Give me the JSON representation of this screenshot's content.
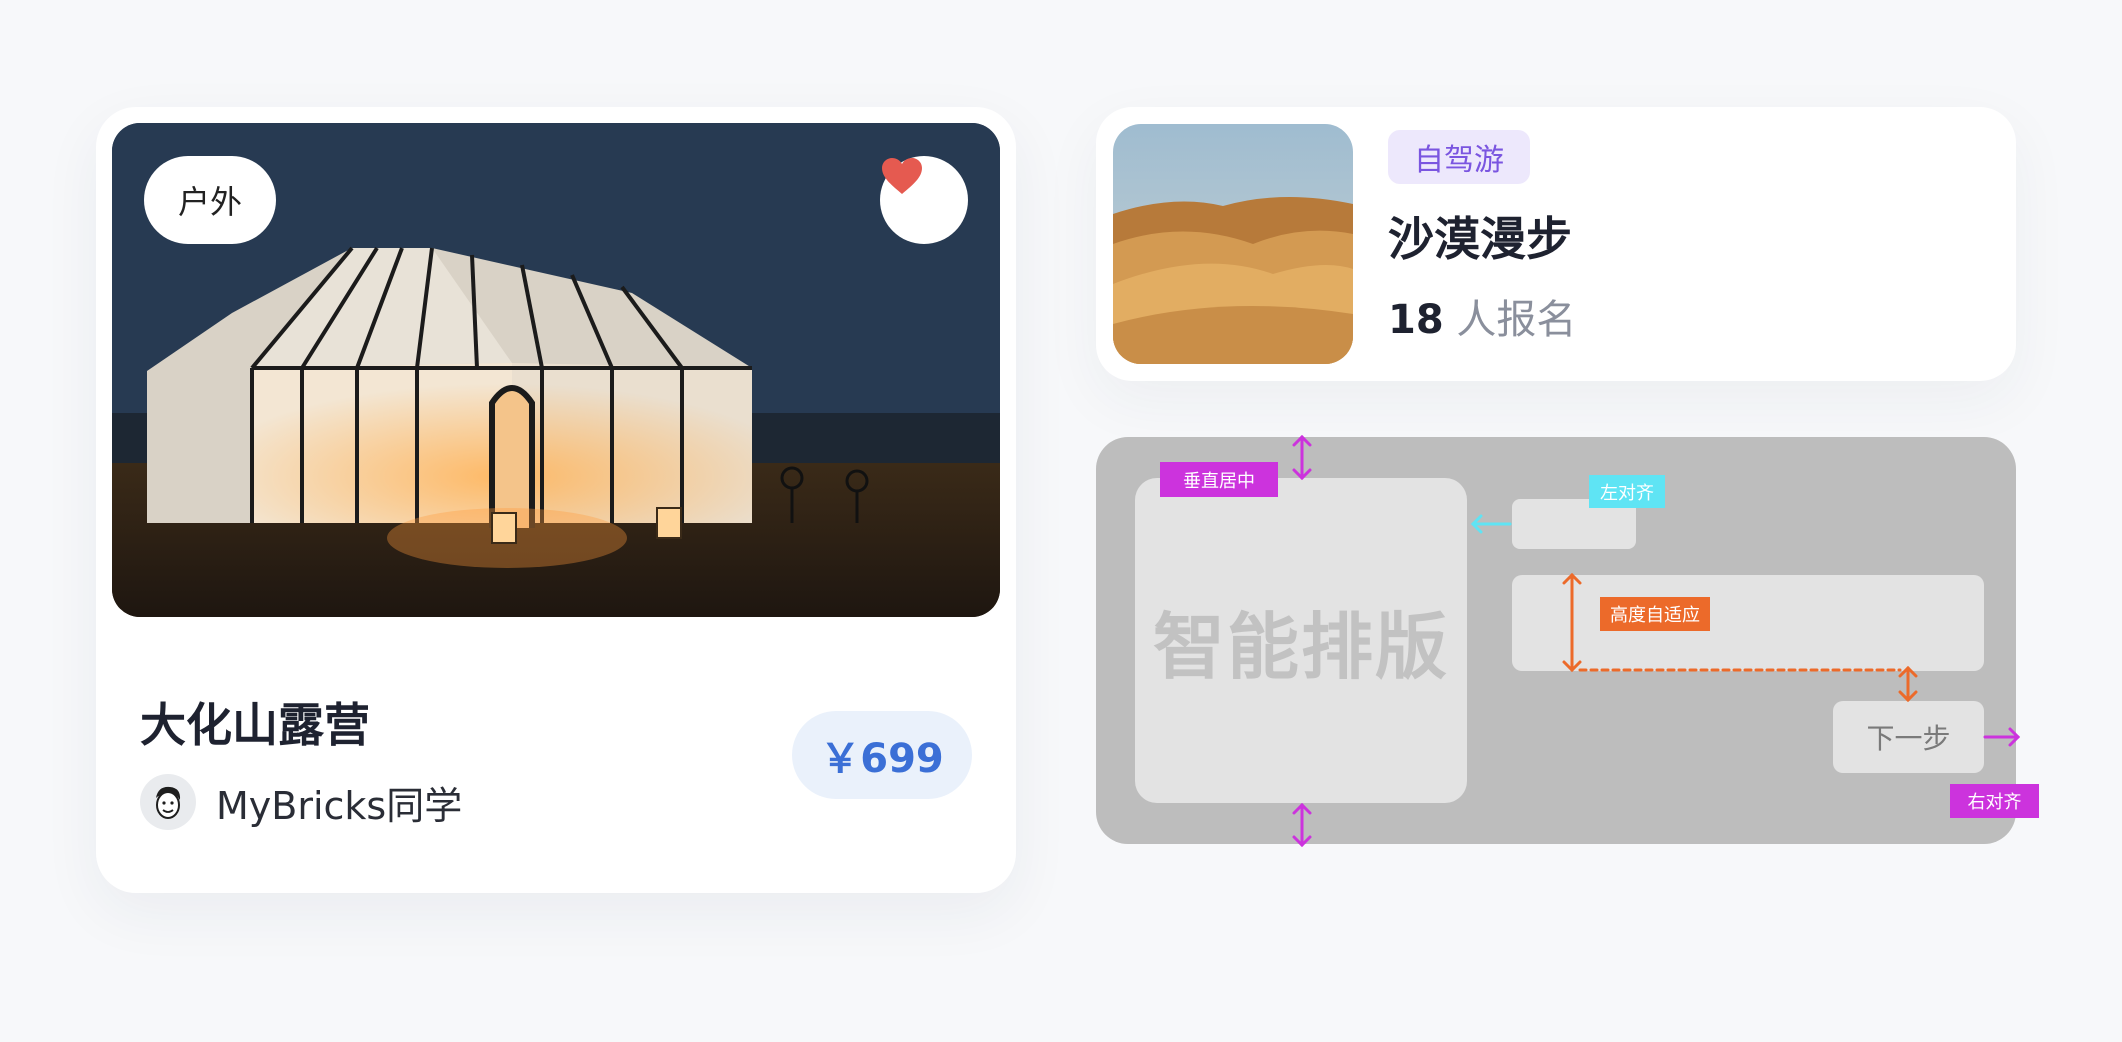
{
  "camp_card": {
    "tag": "户外",
    "title": "大化山露营",
    "author": "MyBricks同学",
    "price": "￥699",
    "favorite_icon": "heart-icon"
  },
  "trip_card": {
    "badge": "自驾游",
    "title": "沙漠漫步",
    "signup_count": "18",
    "signup_suffix": " 人报名"
  },
  "layout_demo": {
    "main_text": "智能排版",
    "button_label": "下一步",
    "annotations": {
      "vertical_center": "垂直居中",
      "left_align": "左对齐",
      "height_adaptive": "高度自适应",
      "right_align": "右对齐"
    }
  },
  "colors": {
    "price_blue": "#3b6fd6",
    "badge_purple": "#7a55e0",
    "heart_red": "#e55a50",
    "magenta": "#cc33dd",
    "cyan": "#5fe4f4",
    "orange": "#ec6a2a"
  }
}
